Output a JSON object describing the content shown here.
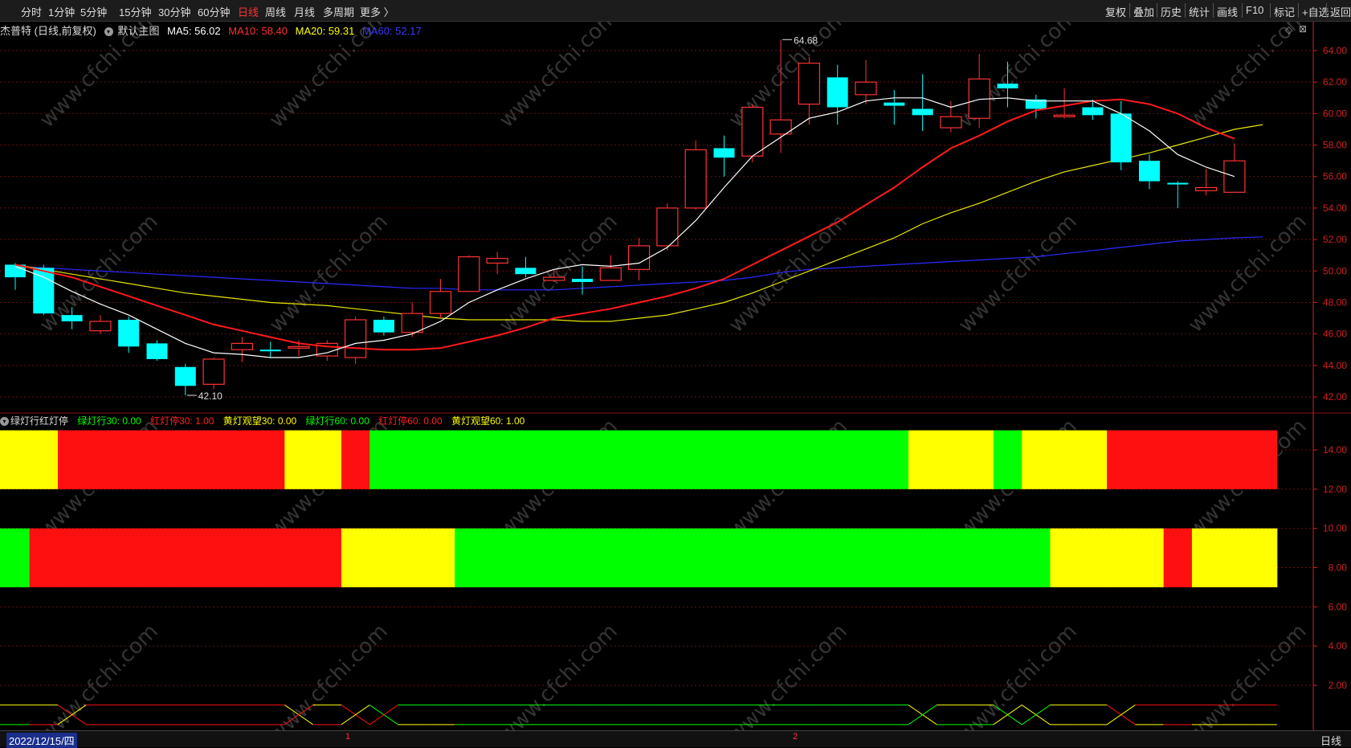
{
  "toolbar": {
    "periods": [
      "分时",
      "1分钟",
      "5分钟",
      "15分钟",
      "30分钟",
      "60分钟",
      "日线",
      "周线",
      "月线",
      "多周期",
      "更多 〉"
    ],
    "active_period": "日线",
    "tools": [
      "复权",
      "叠加",
      "历史",
      "统计",
      "画线",
      "F10",
      "标记",
      "+自选",
      "返回"
    ]
  },
  "info": {
    "stock": "杰普特 (日线,前复权)",
    "template": "默认主图",
    "ma5": "MA5: 56.02",
    "ma10": "MA10: 58.40",
    "ma20": "MA20: 59.31",
    "ma60": "MA60: 52.17"
  },
  "indicator": {
    "name": "绿灯行红灯停",
    "g30": "绿灯行30: 0.00",
    "r30": "红灯停30: 1.00",
    "y30": "黄灯观望30: 0.00",
    "g60": "绿灯行60: 0.00",
    "r60": "红灯停60: 0.00",
    "y60": "黄灯观望60: 1.00"
  },
  "status": {
    "date": "2022/12/15/四",
    "period": "日线",
    "marks": [
      "1",
      "2"
    ]
  },
  "watermark": "www.cfchi.com",
  "colors": {
    "up": "#ff3232",
    "down": "#00ffff",
    "ma5": "#ffffff",
    "ma10": "#ff1a1a",
    "ma20": "#e6e600",
    "ma60": "#2a2aff",
    "green": "#00ff00",
    "yellow": "#ffff00",
    "red": "#ff1010",
    "axis": "#d02020"
  },
  "chart_data": [
    {
      "type": "candlestick",
      "title": "杰普特 (日线,前复权)",
      "ylim": [
        41,
        65.5
      ],
      "y_ticks": [
        "64.00",
        "62.00",
        "60.00",
        "58.00",
        "56.00",
        "54.00",
        "52.00",
        "50.00",
        "48.00",
        "46.00",
        "44.00",
        "42.00"
      ],
      "candles": [
        [
          50.4,
          49.6,
          50.5,
          48.8
        ],
        [
          50.2,
          47.3,
          50.4,
          47.2
        ],
        [
          47.2,
          46.8,
          47.7,
          46.3
        ],
        [
          46.2,
          46.8,
          47.2,
          46.0
        ],
        [
          46.9,
          45.2,
          47.1,
          44.8
        ],
        [
          45.4,
          44.4,
          45.6,
          44.3
        ],
        [
          43.9,
          42.7,
          44.1,
          42.1
        ],
        [
          42.8,
          44.4,
          44.5,
          42.5
        ],
        [
          45.0,
          45.4,
          45.8,
          44.2
        ],
        [
          45.0,
          44.9,
          45.5,
          44.5
        ],
        [
          45.1,
          45.2,
          45.6,
          44.6
        ],
        [
          44.6,
          45.4,
          45.6,
          44.3
        ],
        [
          44.5,
          46.9,
          47.1,
          44.1
        ],
        [
          46.9,
          46.1,
          47.1,
          45.9
        ],
        [
          46.1,
          47.3,
          48.0,
          45.8
        ],
        [
          47.3,
          48.7,
          49.5,
          47.0
        ],
        [
          48.7,
          50.9,
          51.0,
          48.7
        ],
        [
          50.5,
          50.8,
          51.2,
          49.8
        ],
        [
          50.2,
          49.8,
          50.9,
          49.6
        ],
        [
          49.4,
          49.6,
          50.1,
          49.3
        ],
        [
          49.5,
          49.3,
          50.3,
          48.5
        ],
        [
          49.4,
          50.2,
          51.0,
          49.4
        ],
        [
          50.1,
          51.6,
          52.1,
          49.4
        ],
        [
          51.6,
          54.0,
          54.3,
          51.3
        ],
        [
          54.0,
          57.7,
          58.3,
          53.9
        ],
        [
          57.8,
          57.2,
          58.6,
          56.0
        ],
        [
          57.3,
          60.4,
          60.6,
          56.9
        ],
        [
          58.7,
          59.6,
          64.7,
          57.5
        ],
        [
          60.6,
          63.2,
          63.6,
          59.3
        ],
        [
          62.3,
          60.4,
          63.1,
          59.3
        ],
        [
          61.2,
          62.0,
          63.4,
          60.6
        ],
        [
          60.7,
          60.5,
          61.5,
          59.3
        ],
        [
          60.3,
          59.9,
          62.5,
          58.9
        ],
        [
          59.1,
          59.8,
          60.8,
          58.8
        ],
        [
          59.7,
          62.2,
          63.8,
          59.1
        ],
        [
          61.9,
          61.6,
          63.3,
          60.4
        ],
        [
          60.9,
          60.3,
          61.2,
          59.7
        ],
        [
          59.9,
          59.9,
          61.6,
          59.7
        ],
        [
          60.4,
          59.9,
          60.9,
          59.6
        ],
        [
          60.0,
          56.9,
          60.8,
          56.4
        ],
        [
          57.0,
          55.7,
          57.4,
          55.2
        ],
        [
          55.6,
          55.5,
          55.7,
          54.0
        ],
        [
          55.1,
          55.3,
          56.5,
          54.8
        ],
        [
          55.0,
          57.0,
          58.1,
          55.0
        ]
      ],
      "ma5": [
        50.3,
        49.6,
        48.7,
        47.9,
        47.2,
        46.3,
        45.4,
        44.8,
        44.7,
        44.5,
        44.5,
        44.8,
        45.4,
        45.6,
        46.0,
        46.8,
        48.0,
        48.8,
        49.5,
        50.1,
        50.4,
        50.3,
        50.5,
        51.5,
        53.2,
        55.3,
        57.3,
        58.5,
        59.7,
        60.1,
        60.8,
        61.0,
        61.0,
        60.4,
        60.9,
        61.0,
        60.8,
        60.8,
        60.8,
        60.0,
        58.9,
        57.4,
        56.6,
        56.0
      ],
      "ma10": [
        50.4,
        50.0,
        49.6,
        49.0,
        48.4,
        47.8,
        47.2,
        46.6,
        46.2,
        45.8,
        45.4,
        45.2,
        45.1,
        45.0,
        45.0,
        45.1,
        45.5,
        45.9,
        46.4,
        47.0,
        47.3,
        47.6,
        48.0,
        48.4,
        48.9,
        49.5,
        50.4,
        51.3,
        52.2,
        53.1,
        54.2,
        55.3,
        56.6,
        57.8,
        58.6,
        59.5,
        60.2,
        60.5,
        60.8,
        60.9,
        60.6,
        60.0,
        59.1,
        58.4
      ],
      "ma20": [
        50.4,
        50.1,
        49.8,
        49.5,
        49.2,
        48.9,
        48.6,
        48.4,
        48.2,
        48.0,
        47.9,
        47.8,
        47.6,
        47.4,
        47.2,
        47.0,
        46.9,
        46.9,
        46.9,
        46.9,
        46.8,
        46.8,
        47.0,
        47.2,
        47.6,
        48.0,
        48.6,
        49.3,
        50.0,
        50.7,
        51.4,
        52.1,
        53.0,
        53.7,
        54.3,
        55.0,
        55.7,
        56.3,
        56.7,
        57.1,
        57.5,
        58.0,
        58.5,
        59.0,
        59.3
      ],
      "ma60": [
        50.3,
        50.2,
        50.1,
        50.0,
        49.9,
        49.8,
        49.7,
        49.6,
        49.5,
        49.4,
        49.3,
        49.2,
        49.1,
        49.0,
        48.9,
        48.9,
        48.8,
        48.8,
        48.8,
        48.8,
        48.9,
        49.0,
        49.1,
        49.2,
        49.3,
        49.4,
        49.6,
        49.9,
        50.1,
        50.2,
        50.3,
        50.4,
        50.5,
        50.6,
        50.7,
        50.8,
        50.9,
        51.1,
        51.3,
        51.5,
        51.7,
        51.9,
        52.0,
        52.1,
        52.17
      ],
      "annotations": [
        {
          "label": "64.68",
          "candle": 27
        },
        {
          "label": "42.10",
          "candle": 6
        }
      ]
    },
    {
      "type": "bar",
      "name": "绿灯行红灯停",
      "ylim": [
        0,
        16
      ],
      "y_ticks": [
        "14.00",
        "12.00",
        "10.00",
        "8.00",
        "6.00",
        "4.00",
        "2.00"
      ],
      "lane30": [
        "yellow",
        "yellow",
        "red",
        "red",
        "red",
        "red",
        "red",
        "red",
        "red",
        "red",
        "yellow",
        "yellow",
        "red",
        "green",
        "green",
        "green",
        "green",
        "green",
        "green",
        "green",
        "green",
        "green",
        "green",
        "green",
        "green",
        "green",
        "green",
        "green",
        "green",
        "green",
        "green",
        "green",
        "yellow",
        "yellow",
        "yellow",
        "green",
        "yellow",
        "yellow",
        "yellow",
        "red",
        "red",
        "red",
        "red",
        "red",
        "red"
      ],
      "lane60": [
        "green",
        "red",
        "red",
        "red",
        "red",
        "red",
        "red",
        "red",
        "red",
        "red",
        "red",
        "red",
        "yellow",
        "yellow",
        "yellow",
        "yellow",
        "green",
        "green",
        "green",
        "green",
        "green",
        "green",
        "green",
        "green",
        "green",
        "green",
        "green",
        "green",
        "green",
        "green",
        "green",
        "green",
        "green",
        "green",
        "green",
        "green",
        "green",
        "yellow",
        "yellow",
        "yellow",
        "yellow",
        "red",
        "yellow",
        "yellow",
        "yellow"
      ],
      "lane30_range": [
        12,
        15
      ],
      "lane60_range": [
        7,
        10
      ],
      "signal_lines": {
        "upper": 1,
        "lower": 0
      }
    }
  ]
}
